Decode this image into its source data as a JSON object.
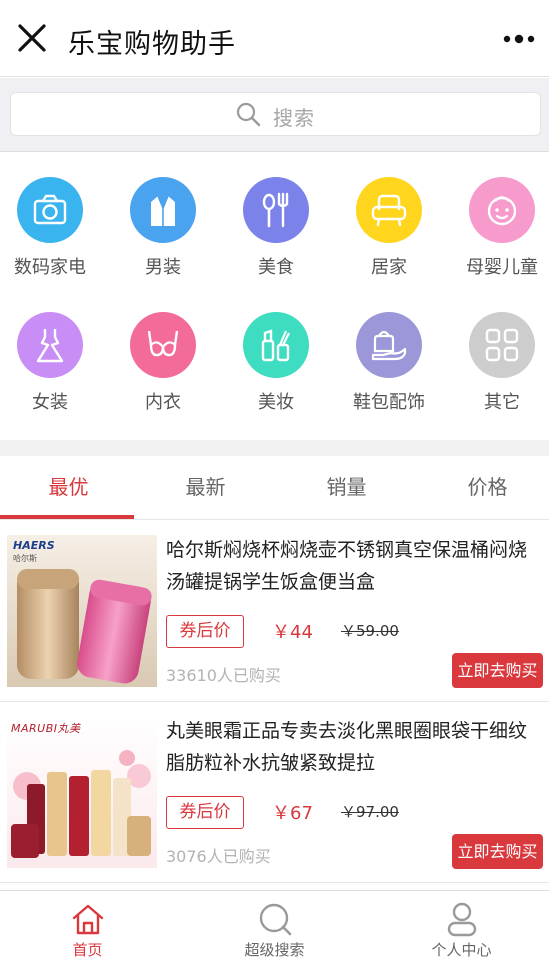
{
  "titlebar": {
    "title": "乐宝购物助手",
    "close_icon": "close-icon",
    "more_icon": "more-dots-icon"
  },
  "search": {
    "placeholder": "搜索",
    "icon": "search-icon"
  },
  "categories": [
    {
      "label": "数码家电",
      "icon": "camera-icon",
      "color": "#3ab4ee"
    },
    {
      "label": "男装",
      "icon": "suit-icon",
      "color": "#4aa3ee"
    },
    {
      "label": "美食",
      "icon": "spoon-fork-icon",
      "color": "#7b83ea"
    },
    {
      "label": "居家",
      "icon": "armchair-icon",
      "color": "#ffd51e"
    },
    {
      "label": "母婴儿童",
      "icon": "baby-face-icon",
      "color": "#f79bcd"
    },
    {
      "label": "女装",
      "icon": "dress-icon",
      "color": "#c88ef5"
    },
    {
      "label": "内衣",
      "icon": "bra-icon",
      "color": "#f36b98"
    },
    {
      "label": "美妆",
      "icon": "cosmetics-icon",
      "color": "#3edcc0"
    },
    {
      "label": "鞋包配饰",
      "icon": "bag-shoe-icon",
      "color": "#9b97d8"
    },
    {
      "label": "其它",
      "icon": "grid-icon",
      "color": "#cdcdcd"
    }
  ],
  "tabs": [
    {
      "label": "最优",
      "active": true
    },
    {
      "label": "最新",
      "active": false
    },
    {
      "label": "销量",
      "active": false
    },
    {
      "label": "价格",
      "active": false
    }
  ],
  "products": [
    {
      "title": "哈尔斯焖烧杯焖烧壶不锈钢真空保温桶闷烧汤罐提锅学生饭盒便当盒",
      "coupon_label": "券后价",
      "price": "￥44",
      "original_price": "￥59.00",
      "sold": "33610人已购买",
      "buy_label": "立即去购买",
      "brand": "HAERS",
      "brand_sub": "哈尔斯"
    },
    {
      "title": "丸美眼霜正品专卖去淡化黑眼圈眼袋干细纹脂肪粒补水抗皱紧致提拉",
      "coupon_label": "券后价",
      "price": "￥67",
      "original_price": "￥97.00",
      "sold": "3076人已购买",
      "buy_label": "立即去购买",
      "brand": "MARUBI",
      "brand_sub": "丸美"
    }
  ],
  "bottom_nav": [
    {
      "label": "首页",
      "icon": "home-icon",
      "active": true
    },
    {
      "label": "超级搜索",
      "icon": "search-icon",
      "active": false
    },
    {
      "label": "个人中心",
      "icon": "user-icon",
      "active": false
    }
  ],
  "colors": {
    "accent": "#d9383d",
    "muted": "#b3b3b3"
  }
}
